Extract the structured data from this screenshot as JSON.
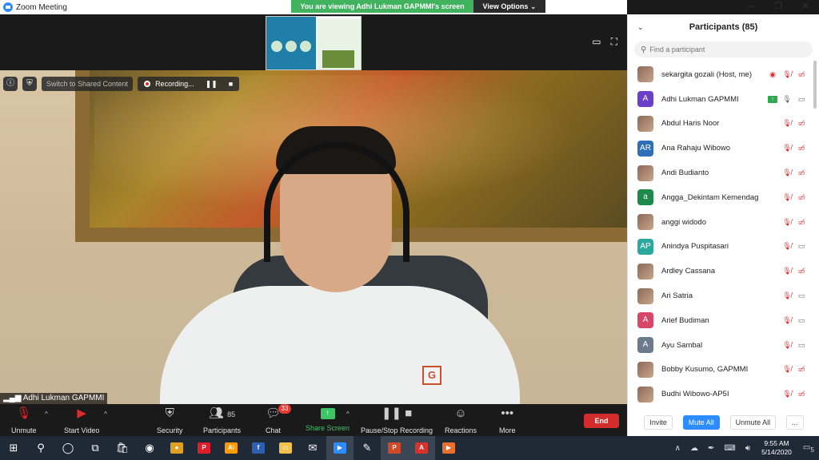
{
  "window": {
    "title": "Zoom Meeting",
    "controls": [
      "—",
      "❐",
      "✕"
    ]
  },
  "share": {
    "banner": "You are viewing Adhi Lukman GAPMMI's screen",
    "view_options": "View Options ⌄"
  },
  "video_bar": {
    "switch_label": "Switch to Shared Content",
    "recording_label": "Recording...",
    "pause_glyph": "❚❚",
    "stop_glyph": "■"
  },
  "speaker": {
    "name": "Adhi Lukman GAPMMI"
  },
  "speaker_logo": "G",
  "toolbar": {
    "unmute": "Unmute",
    "start_video": "Start Video",
    "security": "Security",
    "participants": "Participants",
    "participants_count": "85",
    "chat": "Chat",
    "chat_badge": "33",
    "share_screen": "Share Screen",
    "pause_stop": "Pause/Stop Recording",
    "reactions": "Reactions",
    "more": "More",
    "end": "End"
  },
  "panel": {
    "title": "Participants (85)",
    "search_placeholder": "Find a participant",
    "participants": [
      {
        "name": "sekargita gozali (Host, me)",
        "avatar": "",
        "avatar_color": "#7a6a5a",
        "photo": true,
        "rec": true,
        "share": false,
        "mic": "off",
        "cam": "off"
      },
      {
        "name": "Adhi Lukman GAPMMI",
        "avatar": "A",
        "avatar_color": "#6c3fc9",
        "photo": false,
        "rec": false,
        "share": true,
        "mic": "on",
        "cam": "on"
      },
      {
        "name": "Abdul Haris Noor",
        "avatar": "",
        "avatar_color": "#9b7a62",
        "photo": true,
        "rec": false,
        "share": false,
        "mic": "off",
        "cam": "off"
      },
      {
        "name": "Ana Rahaju Wibowo",
        "avatar": "AR",
        "avatar_color": "#2f6fb5",
        "photo": false,
        "rec": false,
        "share": false,
        "mic": "off",
        "cam": "off"
      },
      {
        "name": "Andi Budianto",
        "avatar": "",
        "avatar_color": "#5b6f4a",
        "photo": true,
        "rec": false,
        "share": false,
        "mic": "off",
        "cam": "off"
      },
      {
        "name": "Angga_Dekintam Kemendag",
        "avatar": "a",
        "avatar_color": "#1d8a4a",
        "photo": false,
        "rec": false,
        "share": false,
        "mic": "off",
        "cam": "off"
      },
      {
        "name": "anggi widodo",
        "avatar": "",
        "avatar_color": "#c84a6a",
        "photo": true,
        "rec": false,
        "share": false,
        "mic": "off",
        "cam": "off"
      },
      {
        "name": "Anindya Puspitasari",
        "avatar": "AP",
        "avatar_color": "#2ba8a0",
        "photo": false,
        "rec": false,
        "share": false,
        "mic": "off",
        "cam": "on"
      },
      {
        "name": "Ardley Cassana",
        "avatar": "",
        "avatar_color": "#4a7a8a",
        "photo": true,
        "rec": false,
        "share": false,
        "mic": "off",
        "cam": "off"
      },
      {
        "name": "Ari Satria",
        "avatar": "",
        "avatar_color": "#b56a7a",
        "photo": true,
        "rec": false,
        "share": false,
        "mic": "off",
        "cam": "on"
      },
      {
        "name": "Arief Budiman",
        "avatar": "A",
        "avatar_color": "#d8466a",
        "photo": false,
        "rec": false,
        "share": false,
        "mic": "off",
        "cam": "on"
      },
      {
        "name": "Ayu Sambal",
        "avatar": "A",
        "avatar_color": "#6b7a8c",
        "photo": false,
        "rec": false,
        "share": false,
        "mic": "off",
        "cam": "on"
      },
      {
        "name": "Bobby Kusumo, GAPMMI",
        "avatar": "",
        "avatar_color": "#555555",
        "photo": true,
        "rec": false,
        "share": false,
        "mic": "off",
        "cam": "off"
      },
      {
        "name": "Budhi Wibowo-AP5I",
        "avatar": "",
        "avatar_color": "#3a3a3a",
        "photo": true,
        "rec": false,
        "share": false,
        "mic": "off",
        "cam": "off"
      }
    ],
    "footer": {
      "invite": "Invite",
      "mute_all": "Mute All",
      "unmute_all": "Unmute All",
      "more": "..."
    }
  },
  "taskbar": {
    "time": "9:55 AM",
    "date": "5/14/2020",
    "notification_count": "5",
    "apps": [
      {
        "icon": "windows-icon",
        "glyph": "⊞",
        "color": "",
        "active": false
      },
      {
        "icon": "search-icon",
        "glyph": "⚲",
        "color": "",
        "active": false
      },
      {
        "icon": "cortana-icon",
        "glyph": "◯",
        "color": "",
        "active": false
      },
      {
        "icon": "task-view-icon",
        "glyph": "⧉",
        "color": "",
        "active": false
      },
      {
        "icon": "store-icon",
        "glyph": "🛍",
        "color": "",
        "active": false
      },
      {
        "icon": "camera-icon",
        "glyph": "◉",
        "color": "",
        "active": false
      },
      {
        "icon": "chrome-icon",
        "glyph": "●",
        "color": "#e0a020",
        "active": false
      },
      {
        "icon": "pinterest-icon",
        "glyph": "P",
        "color": "#e01e2a",
        "active": false
      },
      {
        "icon": "illustrator-icon",
        "glyph": "Ai",
        "color": "#ff9a00",
        "active": false
      },
      {
        "icon": "facebook-icon",
        "glyph": "f",
        "color": "#2d5fb3",
        "active": false
      },
      {
        "icon": "file-explorer-icon",
        "glyph": "▭",
        "color": "#f2c24a",
        "active": false
      },
      {
        "icon": "mail-icon",
        "glyph": "✉",
        "color": "",
        "active": false
      },
      {
        "icon": "zoom-icon",
        "glyph": "▶",
        "color": "#2d8cff",
        "active": true
      },
      {
        "icon": "paint-icon",
        "glyph": "✎",
        "color": "",
        "active": false
      },
      {
        "icon": "powerpoint-icon",
        "glyph": "P",
        "color": "#d04a2a",
        "active": true
      },
      {
        "icon": "acrobat-icon",
        "glyph": "A",
        "color": "#d8322a",
        "active": true
      },
      {
        "icon": "video-player-icon",
        "glyph": "▶",
        "color": "#e8702a",
        "active": false
      }
    ]
  }
}
